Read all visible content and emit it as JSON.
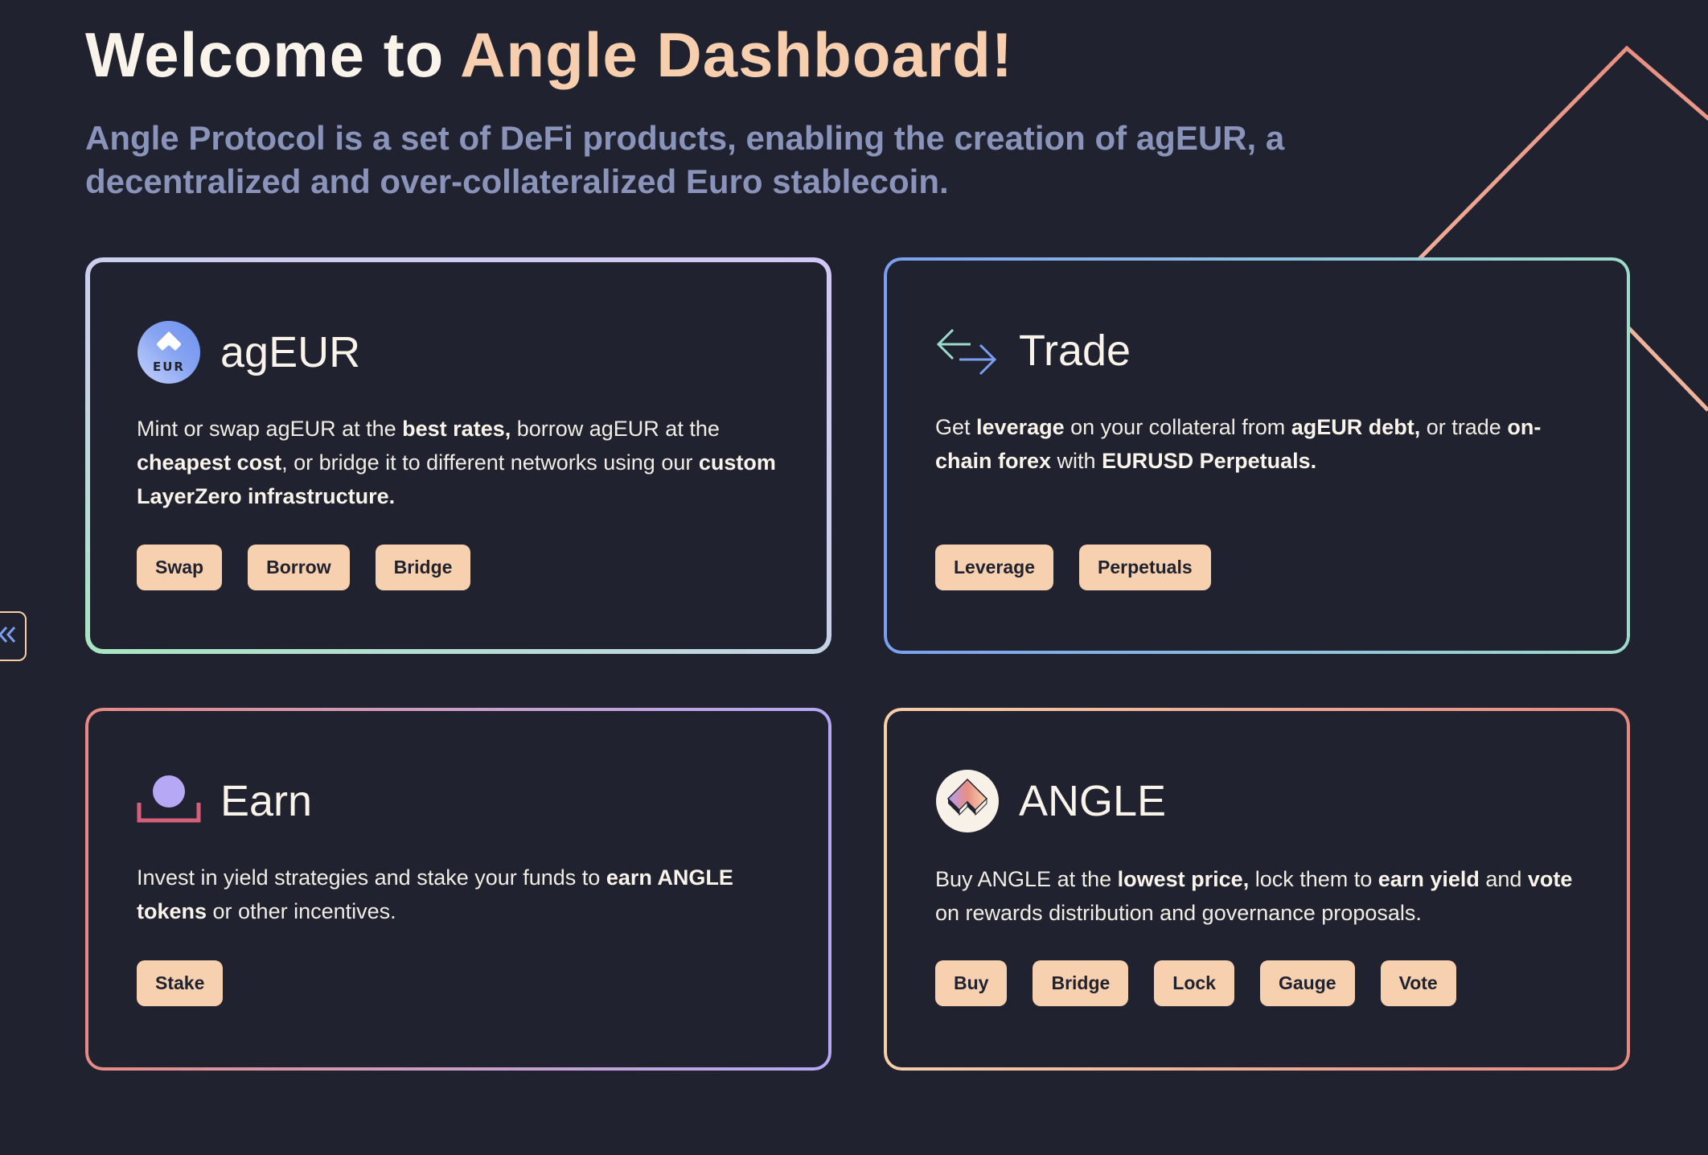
{
  "header": {
    "title_plain": "Welcome to ",
    "title_accent": "Angle Dashboard!",
    "subtitle": "Angle Protocol is a set of DeFi products, enabling the creation of agEUR, a decentralized and over-collateralized Euro stablecoin."
  },
  "colors": {
    "background": "#20232f",
    "text": "#f9f3ea",
    "accent": "#f8cfae",
    "subtitle": "#8a94ba",
    "button_bg": "#f7d0b0",
    "button_text": "#20232f"
  },
  "sidebar_toggle": {
    "icon": "double-chevron-left-icon"
  },
  "cards": [
    {
      "id": "ageur",
      "icon": "ageur-token-icon",
      "icon_label": "EUR",
      "title": "agEUR",
      "description": [
        {
          "text": "Mint or swap agEUR at the ",
          "bold": false
        },
        {
          "text": "best rates,",
          "bold": true
        },
        {
          "text": " borrow agEUR at the ",
          "bold": false
        },
        {
          "text": "cheapest cost",
          "bold": true
        },
        {
          "text": ", or bridge it to different networks using our ",
          "bold": false
        },
        {
          "text": "custom LayerZero infrastructure.",
          "bold": true
        }
      ],
      "buttons": [
        "Swap",
        "Borrow",
        "Bridge"
      ]
    },
    {
      "id": "trade",
      "icon": "swap-arrows-icon",
      "title": "Trade",
      "description": [
        {
          "text": "Get ",
          "bold": false
        },
        {
          "text": "leverage",
          "bold": true
        },
        {
          "text": " on your collateral from ",
          "bold": false
        },
        {
          "text": "agEUR debt,",
          "bold": true
        },
        {
          "text": " or trade ",
          "bold": false
        },
        {
          "text": "on-chain forex",
          "bold": true
        },
        {
          "text": " with ",
          "bold": false
        },
        {
          "text": "EURUSD Perpetuals.",
          "bold": true
        }
      ],
      "buttons": [
        "Leverage",
        "Perpetuals"
      ]
    },
    {
      "id": "earn",
      "icon": "earn-deposit-icon",
      "title": "Earn",
      "description": [
        {
          "text": "Invest in yield strategies and stake your funds to ",
          "bold": false
        },
        {
          "text": "earn ANGLE tokens",
          "bold": true
        },
        {
          "text": " or other incentives.",
          "bold": false
        }
      ],
      "buttons": [
        "Stake"
      ]
    },
    {
      "id": "angle",
      "icon": "angle-token-icon",
      "title": "ANGLE",
      "description": [
        {
          "text": "Buy ANGLE at the ",
          "bold": false
        },
        {
          "text": "lowest price,",
          "bold": true
        },
        {
          "text": " lock them to ",
          "bold": false
        },
        {
          "text": "earn yield",
          "bold": true
        },
        {
          "text": " and ",
          "bold": false
        },
        {
          "text": "vote",
          "bold": true
        },
        {
          "text": " on rewards distribution and governance proposals.",
          "bold": false
        }
      ],
      "buttons": [
        "Buy",
        "Bridge",
        "Lock",
        "Gauge",
        "Vote"
      ]
    }
  ]
}
